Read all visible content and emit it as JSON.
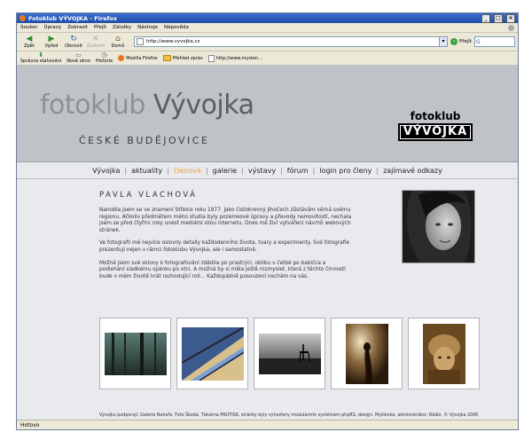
{
  "window": {
    "title": "Fotoklub VÝVOJKA - Firefox",
    "controls": [
      "_",
      "□",
      "×"
    ]
  },
  "menubar": [
    "Soubor",
    "Úpravy",
    "Zobrazit",
    "Přejít",
    "Záložky",
    "Nástroje",
    "Nápověda"
  ],
  "toolbar": {
    "back": "Zpět",
    "forward": "Vpřed",
    "reload": "Obnovit",
    "stop": "Zastavit",
    "home": "Domů",
    "url": "http://www.vyvojka.cz",
    "go": "Přejít"
  },
  "bookmarks": [
    {
      "label": "Správce stahování",
      "icon": "download-icon"
    },
    {
      "label": "Nové okno",
      "icon": "window-icon"
    },
    {
      "label": "Historie",
      "icon": "history-icon"
    },
    {
      "label": "Mozilla Firefox",
      "icon": "firefox-icon"
    },
    {
      "label": "Přehled zpráv",
      "icon": "folder-icon"
    },
    {
      "label": "http://www.mysten...",
      "icon": "page-icon"
    }
  ],
  "site": {
    "logo_part1": "fotoklub ",
    "logo_part2": "Vývojka",
    "logo_sub": "ČESKÉ BUDĚJOVICE",
    "badge_top": "fotoklub",
    "badge_bottom": "VÝVOJKA",
    "nav": [
      {
        "label": "Vývojka",
        "active": false
      },
      {
        "label": "aktuality",
        "active": false
      },
      {
        "label": "členové",
        "active": true
      },
      {
        "label": "galerie",
        "active": false
      },
      {
        "label": "výstavy",
        "active": false
      },
      {
        "label": "fórum",
        "active": false
      },
      {
        "label": "login pro členy",
        "active": false
      },
      {
        "label": "zajímavé odkazy",
        "active": false
      }
    ],
    "person_name": "PAVLA VLACHOVÁ",
    "bio": [
      "Narodila jsem se ve znamení Střelce roku 1977. Jako čistokrevný Jihočech zůstávám věrná svému regionu. Ačkoliv předmětem mého studia byly pozemkové úpravy a převody nemovitostí, nechala jsem se před čtyřmi roky unést mediální silou internetu. Dnes mě živí vytváření návrhů webových stránek.",
      "Ve fotografii mě nejvíce oslovily detaily každodenního života, tvary a experimenty. Své fotografie prezentuji nejen v rámci fotoklubu Vývojka, ale i samostatně.",
      "Možná jsem své sklony k fotografování zdědila po prastrýci, oblibu v četbě po babičce a podlehání sladkému spánku po otci. A možná by si měla ještě rozmyslet, která z těchto činností bude v mém životě hrát rozhodující roli... Každopádně posouzení nechám na vás."
    ],
    "footer": "Vývojku podporují: Galerie Nahoře, Foto Škoda, Tiskárna PROTISK, stránky byly vytvořeny modulárním systémem phpRS, design: Myšlenka, administrátor: Rádio, © Vývojka 2006"
  },
  "status": "Hotovo",
  "colors": {
    "header_bg": "#bfc3c7",
    "content_bg": "#e9eaed",
    "nav_active": "#e8a040",
    "titlebar": "#214ea8"
  }
}
